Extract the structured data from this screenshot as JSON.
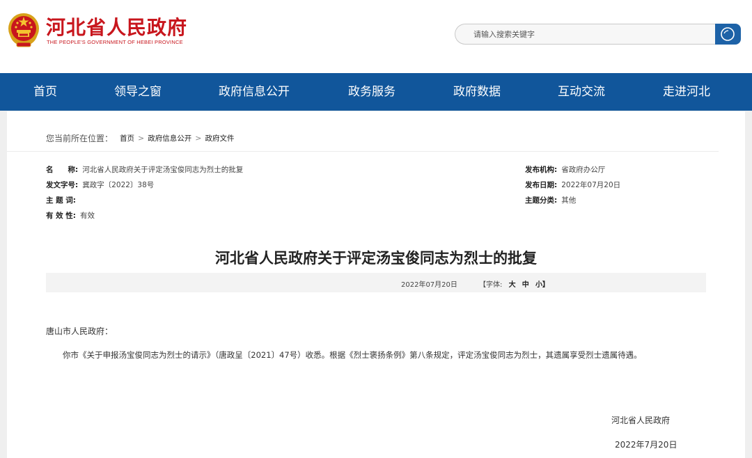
{
  "header": {
    "brand_cn": "河北省人民政府",
    "brand_en": "THE PEOPLE'S GOVERNMENT OF HEBEI PROVINCE",
    "emblem_icon": "national-emblem-icon",
    "search": {
      "placeholder": "请输入搜索关键字",
      "button_icon": "search-icon"
    }
  },
  "nav": {
    "items": [
      {
        "label": "首页"
      },
      {
        "label": "领导之窗"
      },
      {
        "label": "政府信息公开"
      },
      {
        "label": "政务服务"
      },
      {
        "label": "政府数据"
      },
      {
        "label": "互动交流"
      },
      {
        "label": "走进河北"
      }
    ]
  },
  "breadcrumb": {
    "label": "您当前所在位置：",
    "items": [
      "首页",
      "政府信息公开",
      "政府文件"
    ],
    "separator": ">"
  },
  "meta": {
    "name_key": "名　　称:",
    "name_value": "河北省人民政府关于评定汤宝俊同志为烈士的批复",
    "doc_no_key": "发文字号:",
    "doc_no_value": "冀政字〔2022〕38号",
    "topic_key": "主 题 词:",
    "topic_value": "",
    "validity_key": "有 效 性:",
    "validity_value": "有效",
    "issuer_key": "发布机构:",
    "issuer_value": "省政府办公厅",
    "date_key": "发布日期:",
    "date_value": "2022年07月20日",
    "category_key": "主题分类:",
    "category_value": "其他"
  },
  "document": {
    "title": "河北省人民政府关于评定汤宝俊同志为烈士的批复",
    "date_bar": {
      "date": "2022年07月20日",
      "font_prefix": "【字体:",
      "font_large": "大",
      "font_medium": "中",
      "font_small": "小】"
    },
    "salutation": "唐山市人民政府：",
    "paragraph": "你市《关于申报汤宝俊同志为烈士的请示》（唐政呈〔2021〕47号）收悉。根据《烈士褒扬条例》第八条规定，评定汤宝俊同志为烈士，其遗属享受烈士遗属待遇。",
    "signature": "河北省人民政府",
    "sign_date": "2022年7月20日"
  },
  "colors": {
    "brand_red": "#c8161d",
    "nav_blue": "#11569b",
    "search_blue": "#1d62a7"
  }
}
